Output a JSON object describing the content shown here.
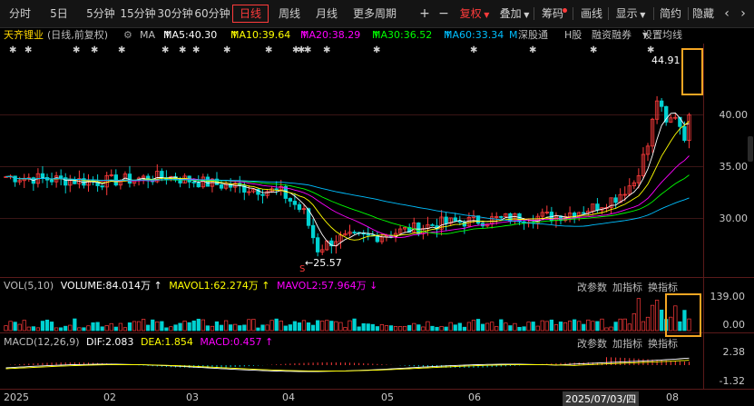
{
  "toolbar": {
    "periods": [
      "分时",
      "5日",
      "5分钟",
      "15分钟",
      "30分钟",
      "60分钟",
      "日线",
      "周线",
      "月线",
      "更多周期"
    ],
    "active_period": "日线",
    "fuquan": "复权",
    "diejia": "叠加",
    "choumalabel": "筹码",
    "huaxian": "画线",
    "xianshi": "显示",
    "jianyue": "简约",
    "yincang": "隐藏"
  },
  "infobar": {
    "stock_name": "天齐锂业",
    "stock_sub": "(日线,前复权)",
    "ma_label": "MA",
    "ma5": "MA5:40.30",
    "ma10": "MA10:39.64",
    "ma20": "MA20:38.29",
    "ma30": "MA30:36.52",
    "ma60": "MA60:33.34",
    "m_label": "M",
    "shengu": "深股通",
    "hgu": "H股",
    "rongzi": "融资融券",
    "setma": "设置均线"
  },
  "price_axis": [
    "40.00",
    "35.00",
    "30.00"
  ],
  "annotations": {
    "high": "44.91",
    "low": "25.57"
  },
  "volume": {
    "title": "VOL(5,10)",
    "volume": "VOLUME:84.014万",
    "mavol1": "MAVOL1:62.274万",
    "mavol2": "MAVOL2:57.964万",
    "btn_params": "改参数",
    "btn_add": "加指标",
    "btn_switch": "换指标",
    "axis_top": "139.00",
    "axis_bottom": "0.00"
  },
  "macd": {
    "title": "MACD(12,26,9)",
    "dif": "DIF:2.083",
    "dea": "DEA:1.854",
    "macd": "MACD:0.457",
    "btn_params": "改参数",
    "btn_add": "加指标",
    "btn_switch": "换指标",
    "axis_top": "2.38",
    "axis_bottom": "-1.32"
  },
  "xaxis": [
    "2025",
    "02",
    "03",
    "04",
    "05",
    "06",
    "2025/07/03/四",
    "08"
  ],
  "colors": {
    "up": "#ff3b3b",
    "down": "#00d2d2",
    "ma5": "#ffffff",
    "ma10": "#ffff00",
    "ma20": "#ff00ff",
    "ma30": "#00ff00",
    "ma60": "#00bfff",
    "highlight": "#f5a623"
  }
}
